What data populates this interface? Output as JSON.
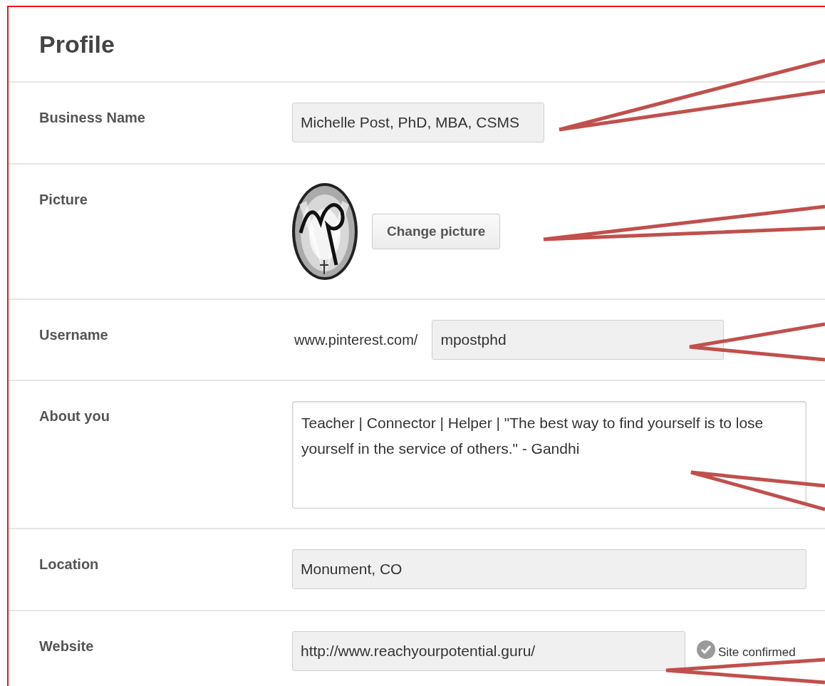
{
  "title": "Profile",
  "fields": [
    {
      "kind": "text",
      "label": "Business Name",
      "value": "Michelle Post, PhD, MBA, CSMS"
    },
    {
      "kind": "picture",
      "label": "Picture",
      "button": "Change picture"
    },
    {
      "kind": "username",
      "label": "Username",
      "prefix": "www.pinterest.com/",
      "value": "mpostphd"
    },
    {
      "kind": "textarea",
      "label": "About you",
      "value": "Teacher | Connector | Helper | \"The best way to find yourself is to lose yourself in the service of others.\" - Gandhi"
    },
    {
      "kind": "text",
      "label": "Location",
      "value": "Monument, CO"
    },
    {
      "kind": "website",
      "label": "Website",
      "value": "http://www.reachyourpotential.guru/",
      "status": "Site confirmed",
      "confirmed": true
    }
  ]
}
